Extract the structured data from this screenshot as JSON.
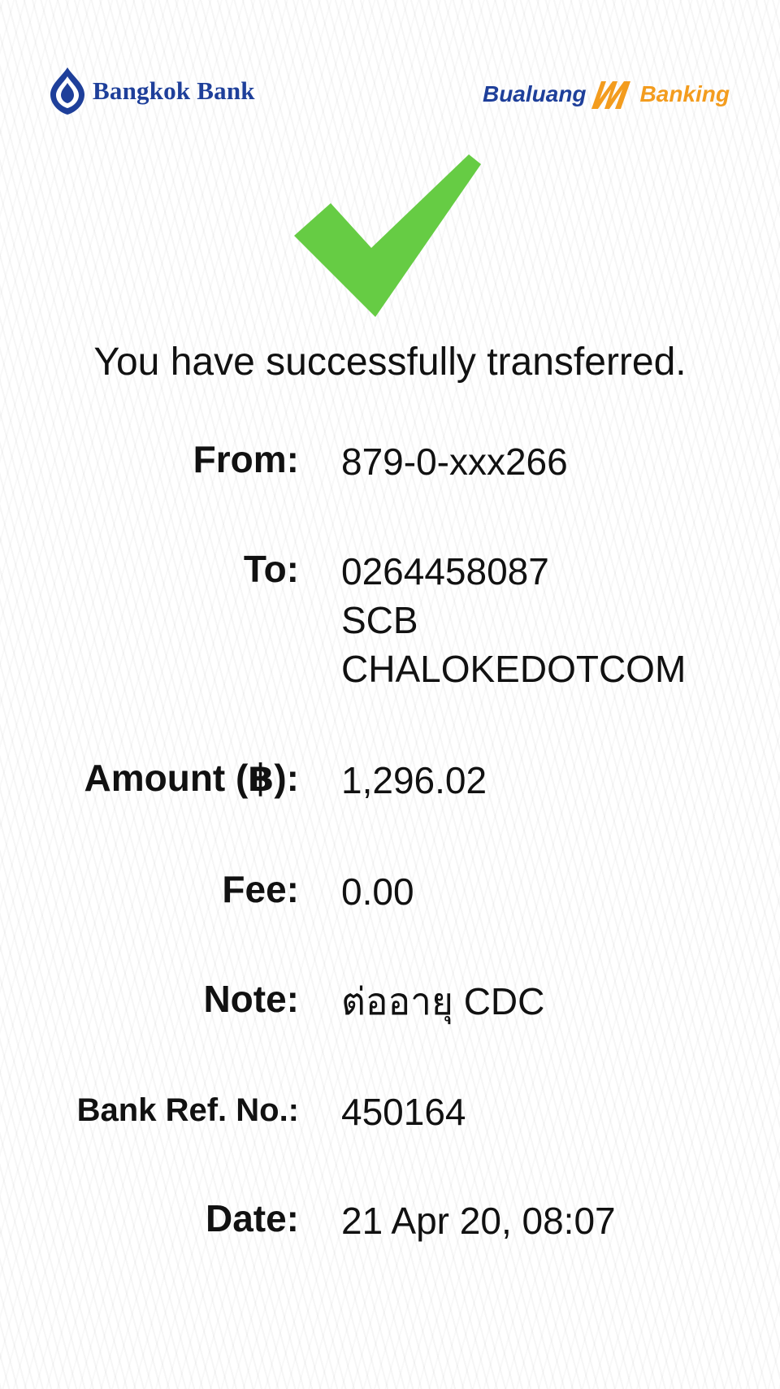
{
  "header": {
    "bank_name": "Bangkok Bank",
    "app_name_left": "Bualuang",
    "app_name_right": "Banking"
  },
  "status": {
    "icon": "checkmark-icon",
    "color": "#66cc44",
    "message": "You have successfully transferred."
  },
  "details": {
    "from": {
      "label": "From:",
      "value": "879-0-xxx266"
    },
    "to": {
      "label": "To:",
      "account": "0264458087",
      "bank": "SCB",
      "name": "CHALOKEDOTCOM"
    },
    "amount": {
      "label": "Amount (฿):",
      "value": "1,296.02"
    },
    "fee": {
      "label": "Fee:",
      "value": "0.00"
    },
    "note": {
      "label": "Note:",
      "value": "ต่ออายุ CDC"
    },
    "bank_ref": {
      "label": "Bank Ref. No.:",
      "value": "450164"
    },
    "date": {
      "label": "Date:",
      "value": "21 Apr 20, 08:07"
    }
  },
  "colors": {
    "brand_blue": "#1e3f9a",
    "brand_orange": "#f39c1e",
    "success_green": "#66cc44"
  }
}
